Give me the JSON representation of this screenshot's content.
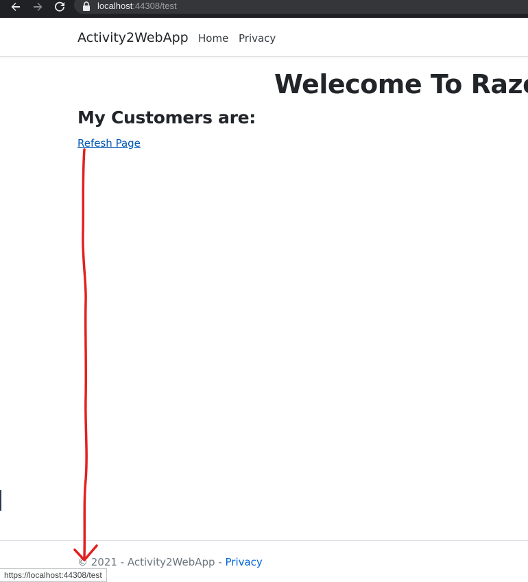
{
  "browser": {
    "url_host": "localhost",
    "url_rest": ":44308/test",
    "status_url": "https://localhost:44308/test"
  },
  "navbar": {
    "brand": "Activity2WebApp",
    "links": [
      "Home",
      "Privacy"
    ]
  },
  "main": {
    "title": "Welecome To Razor",
    "subtitle": "My Customers are:",
    "refresh_link": "Refesh Page"
  },
  "footer": {
    "copyright": "© 2021 - Activity2WebApp - ",
    "privacy_link": "Privacy"
  },
  "colors": {
    "link": "#0056b3",
    "annotation": "#e32020",
    "chrome": "#202124"
  }
}
